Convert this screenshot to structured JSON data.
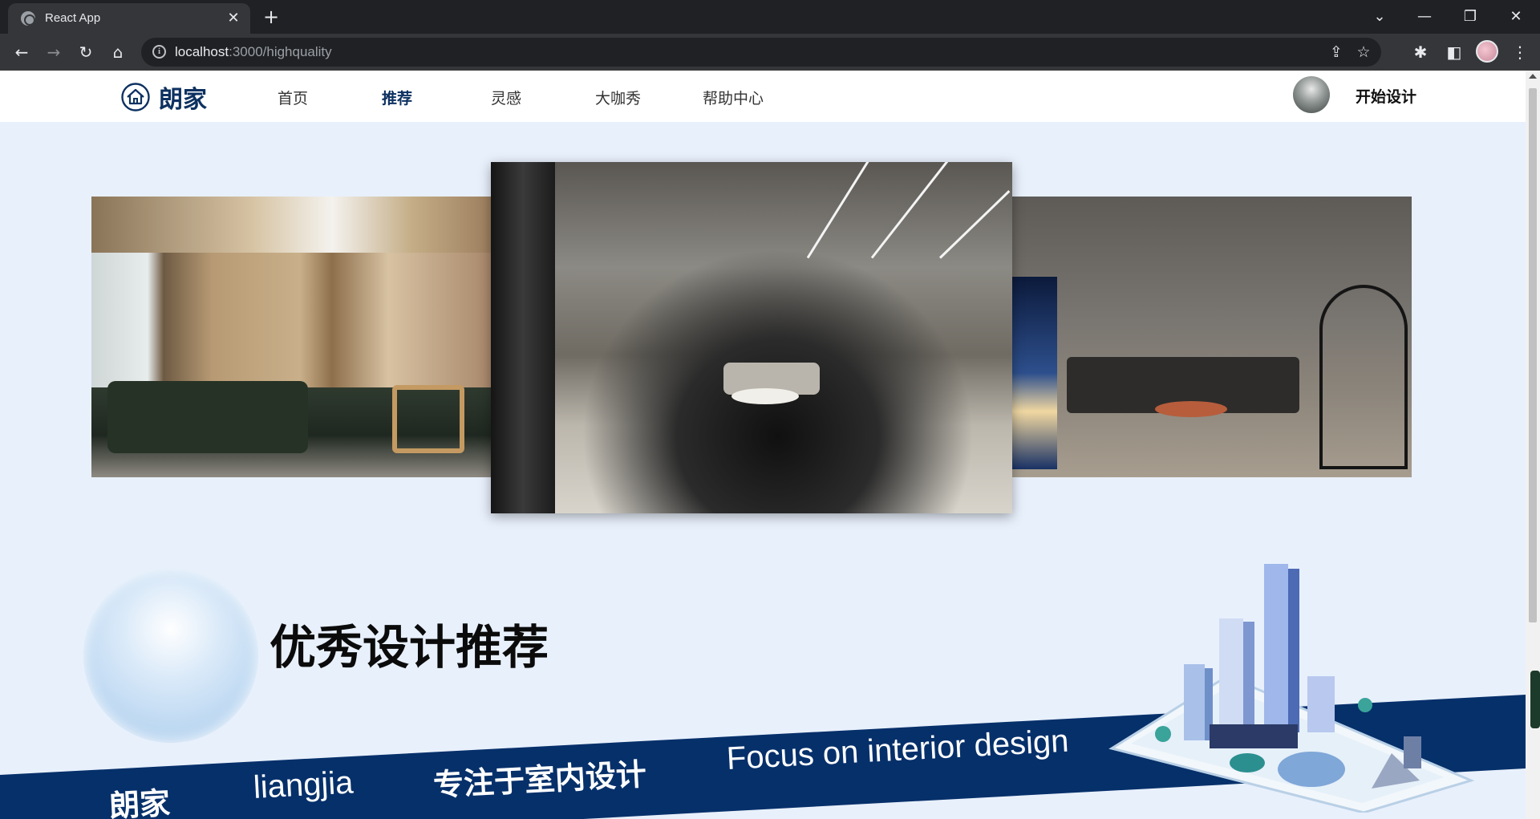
{
  "browser": {
    "tab_title": "React App",
    "url_host": "localhost",
    "url_rest": ":3000/highquality"
  },
  "site": {
    "logo_text": "朗家",
    "nav": [
      "首页",
      "推荐",
      "灵感",
      "大咖秀",
      "帮助中心"
    ],
    "active_nav": "推荐",
    "start_design_label": "开始设计"
  },
  "banner": {
    "section_title": "优秀设计推荐",
    "strip_texts": [
      "朗家",
      "liangjia",
      "专注于室内设计",
      "Focus on interior design"
    ]
  },
  "colors": {
    "brand_navy": "#0d3161",
    "page_background": "#e8f0fc",
    "banner_strip": "#06306a"
  },
  "icons": {
    "logo": "house-icon",
    "tab_favicon": "globe-icon"
  }
}
